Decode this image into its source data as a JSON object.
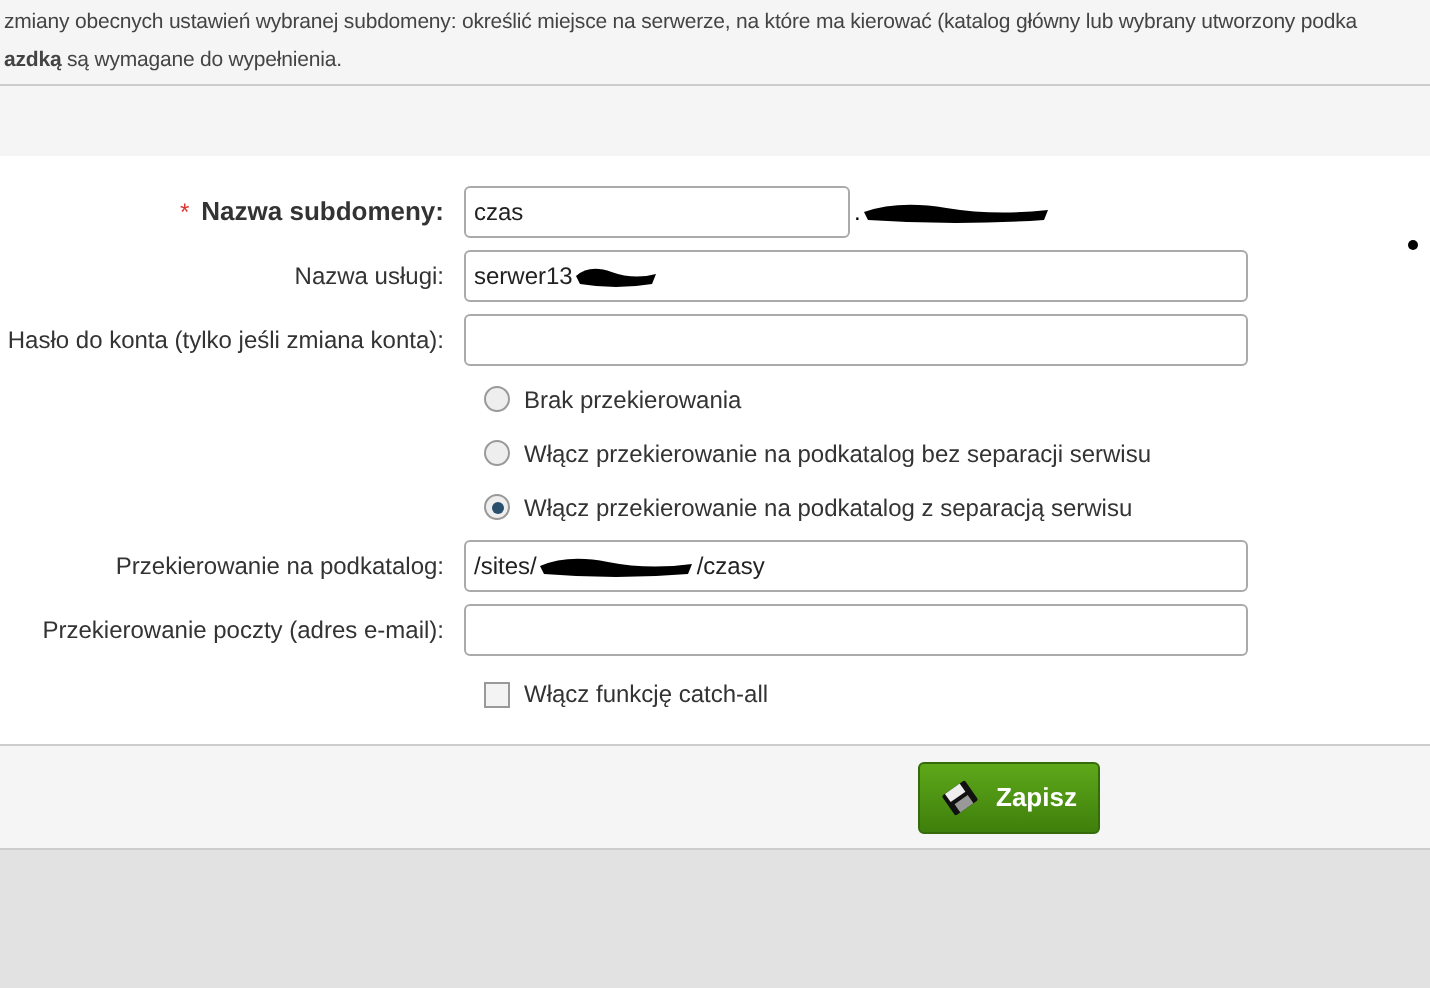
{
  "intro": {
    "line_1": "zmiany obecnych ustawień wybranej subdomeny: określić miejsce na serwerze, na które ma kierować (katalog główny lub wybrany utworzony podka",
    "line_2": "**azdką** są wymagane do wypełnienia."
  },
  "fields": [
    {
      "kind": "text",
      "label": "Nazwa subdomeny:",
      "required_mark": "*",
      "value": "czas",
      "suffix": ".",
      "redacted": true
    },
    {
      "kind": "text",
      "label": "Nazwa usługi:",
      "value": "serwer13",
      "redacted": true
    },
    {
      "kind": "text",
      "label": "Hasło do konta (tylko jeśli zmiana konta):"
    },
    {
      "kind": "radio",
      "label": "Brak przekierowania",
      "selected": false
    },
    {
      "kind": "radio",
      "label": "Włącz przekierowanie na podkatalog bez separacji serwisu",
      "selected": false
    },
    {
      "kind": "radio",
      "label": "Włącz przekierowanie na podkatalog z separacją serwisu",
      "selected": true
    },
    {
      "kind": "text",
      "label": "Przekierowanie na podkatalog:",
      "value": "/sites/",
      "value_after": "/czasy",
      "redacted": true
    },
    {
      "kind": "text",
      "label": "Przekierowanie poczty (adres e-mail):"
    },
    {
      "kind": "checkbox",
      "label": "Włącz funkcję catch-all",
      "checked": false
    }
  ],
  "save_button": {
    "label": "Zapisz"
  }
}
